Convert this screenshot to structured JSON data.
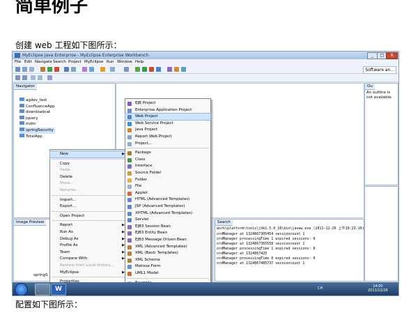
{
  "doc": {
    "heading": "简单例子",
    "para1": "创建 web 工程如下图所示：",
    "para2": "配置如下图所示："
  },
  "window": {
    "title": "MyEclipse Java Enterprise - MyEclipse Enterprise Workbench",
    "controls": [
      "_",
      "□",
      "X"
    ]
  },
  "menubar": [
    "File",
    "Edit",
    "Navigate",
    "Search",
    "Project",
    "MyEclipse",
    "Run",
    "Window",
    "Help"
  ],
  "perspective": "Software an...",
  "navigator": {
    "tab": "Navigator",
    "items": [
      "agdev_test",
      "ConfluenceApp",
      "downloadcat",
      "jquery",
      "mdm",
      "springSecurity",
      "TotalApp"
    ]
  },
  "outline": {
    "tab": "Ou",
    "message": "An outline is not available."
  },
  "image_preview": {
    "tab": "Image Preview"
  },
  "console": {
    "tab": "Search",
    "header": "work\\platform\\tools\\jdk1.5.0_18\\bin\\javaw.exe (2011-12-26 上午10:23:10)",
    "lines": [
      "ordManager at 1324867305454 sessioncount 1",
      "ordManager processingTime 1 expired sessions: 0",
      "ordManager at 1324867365558 sessioncount 1",
      "ordManager processingTime 1 expired sessions: 0",
      "ordManager at 1324867425",
      "ordManager processingTime 0 expired sessions: 0",
      "ordManager at 1324867485737 sessioncount 1"
    ]
  },
  "context_menu": {
    "items": [
      {
        "label": "New",
        "sub": true,
        "hl": true
      },
      {
        "label": "Copy"
      },
      {
        "label": "Paste",
        "dis": true
      },
      {
        "label": "Delete"
      },
      {
        "label": "Move...",
        "dis": true
      },
      {
        "label": "Rename...",
        "dis": true
      },
      {
        "label": "Import..."
      },
      {
        "label": "Export..."
      },
      {
        "label": "Open Project"
      },
      {
        "label": "Report",
        "sub": true
      },
      {
        "label": "Run As",
        "sub": true
      },
      {
        "label": "Debug As",
        "sub": true
      },
      {
        "label": "Profile As",
        "sub": true
      },
      {
        "label": "Team",
        "sub": true
      },
      {
        "label": "Compare With",
        "sub": true
      },
      {
        "label": "Restore from Local History...",
        "dis": true
      },
      {
        "label": "MyEclipse",
        "sub": true
      },
      {
        "label": "Properties"
      }
    ]
  },
  "new_submenu": {
    "items": [
      {
        "label": "EJB Project"
      },
      {
        "label": "Enterprise Application Project"
      },
      {
        "label": "Web Project",
        "hl": true
      },
      {
        "label": "Web Service Project"
      },
      {
        "label": "Java Project"
      },
      {
        "label": "Report Web Project"
      },
      {
        "label": "Project..."
      },
      {
        "label": "Package"
      },
      {
        "label": "Class"
      },
      {
        "label": "Interface"
      },
      {
        "label": "Source Folder"
      },
      {
        "label": "Folder"
      },
      {
        "label": "File"
      },
      {
        "label": "Applet"
      },
      {
        "label": "HTML (Advanced Templates)"
      },
      {
        "label": "JSP (Advanced Templates)"
      },
      {
        "label": "XHTML (Advanced Templates)"
      },
      {
        "label": "Servlet"
      },
      {
        "label": "EJB3 Session Bean"
      },
      {
        "label": "EJB3 Entity Bean"
      },
      {
        "label": "EJB3 Message Driven Bean"
      },
      {
        "label": "XML (Advanced Templates)"
      },
      {
        "label": "XML (Basic Templates)"
      },
      {
        "label": "XML Schema"
      },
      {
        "label": "Matisse Form"
      },
      {
        "label": "UML1 Model"
      },
      {
        "label": "Example..."
      },
      {
        "label": "Other...",
        "shortcut": "Ctrl+N"
      }
    ]
  },
  "status": {
    "project": "springS"
  },
  "taskbar": {
    "word": "W",
    "ime": "CH",
    "time": "14:00",
    "date": "2011/12/26"
  },
  "colors": {
    "highlight": "#cfe3fb",
    "taskbar": "#2a4a78",
    "folder": "#5b8bd0"
  }
}
